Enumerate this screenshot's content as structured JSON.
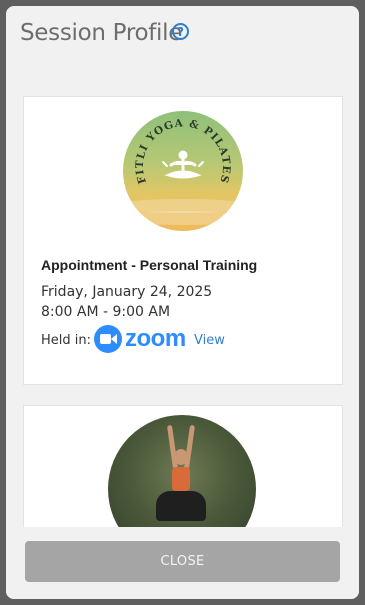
{
  "modal": {
    "title": "Session Profile",
    "help_icon": "help-circle-icon"
  },
  "session": {
    "logo_text": "FITLI YOGA & PILATES",
    "name": "Appointment - Personal Training",
    "date": "Friday, January 24, 2025",
    "time": "8:00 AM - 9:00 AM",
    "held_in_label": "Held in:",
    "platform": "zoom",
    "view_label": "View"
  },
  "instructor": {
    "photo_icon": "instructor-photo"
  },
  "footer": {
    "close_label": "CLOSE"
  },
  "colors": {
    "accent": "#2f7fcc",
    "zoom_blue": "#2d8cff",
    "close_button": "#a5a5a5",
    "backdrop": "#5f5f5f",
    "modal_bg": "#f1f1f1"
  }
}
